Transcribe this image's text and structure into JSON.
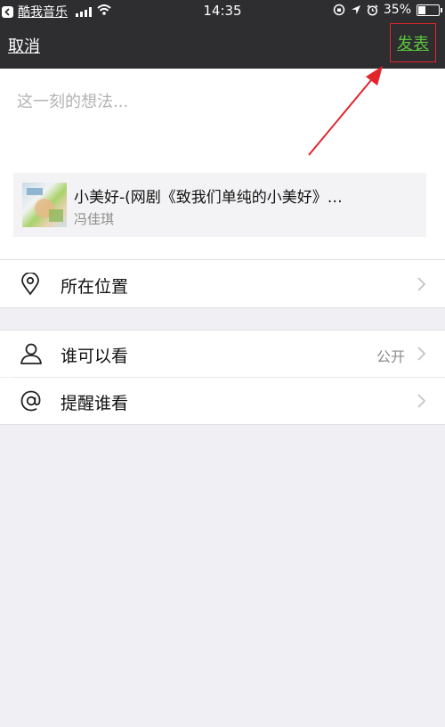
{
  "status_bar": {
    "back_app": "酷我音乐",
    "time": "14:35",
    "battery": "35%",
    "battery_level": 0.35
  },
  "nav": {
    "cancel_label": "取消",
    "publish_label": "发表"
  },
  "compose": {
    "placeholder": "这一刻的想法..."
  },
  "music": {
    "title": "小美好-(网剧《致我们单纯的小美好》…",
    "artist": "冯佳琪"
  },
  "options": {
    "location_label": "所在位置",
    "visibility_label": "谁可以看",
    "visibility_value": "公开",
    "remind_label": "提醒谁看"
  },
  "icons": {
    "location": "location-pin-icon",
    "visibility": "person-icon",
    "remind": "at-sign-icon",
    "chevron": "chevron-right-icon"
  },
  "colors": {
    "nav_background": "#2e2e31",
    "publish_text": "#5ac53c",
    "highlight_box": "#e3242b",
    "page_background": "#efeff4"
  }
}
